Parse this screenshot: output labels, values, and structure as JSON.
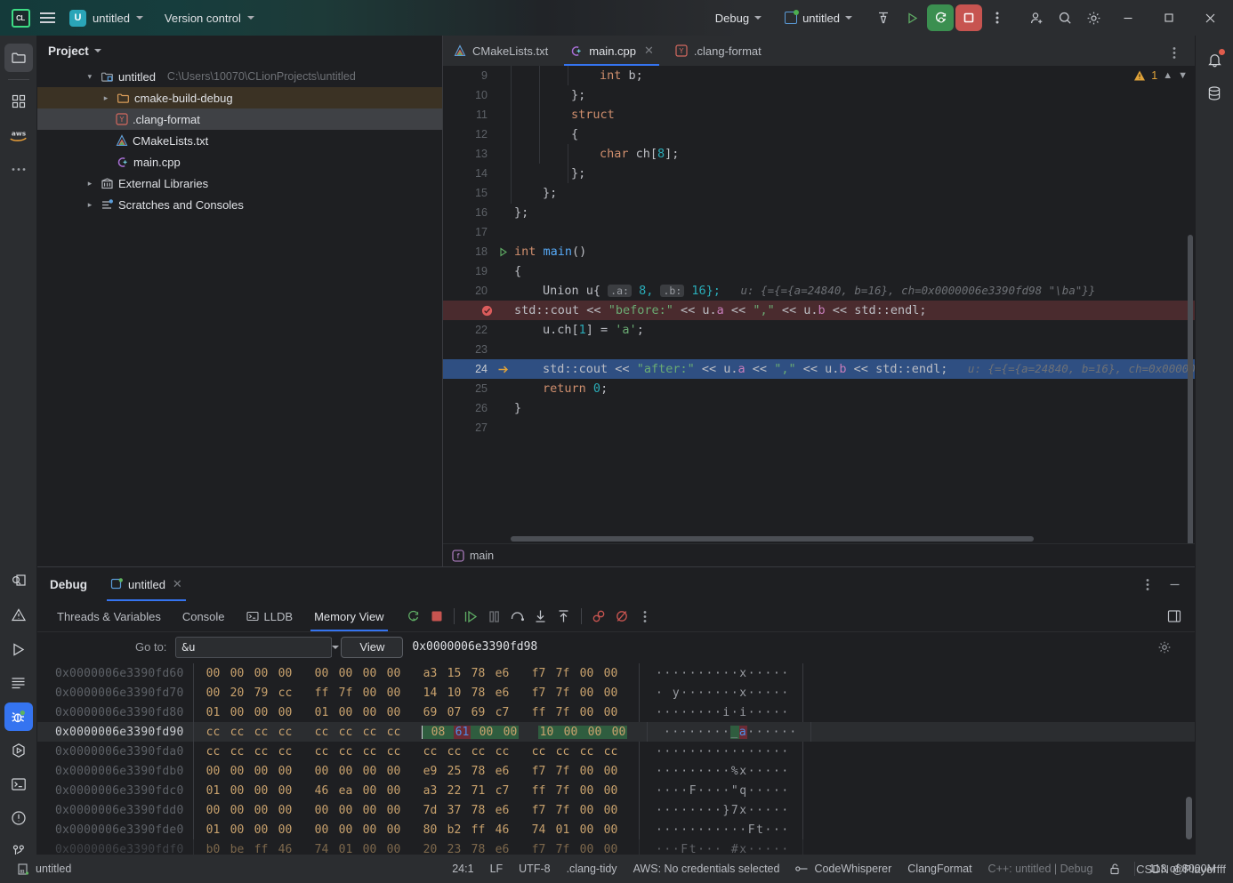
{
  "titlebar": {
    "logo": "clion-logo",
    "logo_text": "CL",
    "project_badge": "U",
    "project_name": "untitled",
    "version_control": "Version control",
    "run_config_label": "Debug",
    "run_target": "untitled",
    "icons": [
      "menu-icon",
      "build-hammer-icon",
      "run-icon",
      "debug-icon",
      "stop-icon",
      "more-icon",
      "add-user-icon",
      "search-icon",
      "settings-gear-icon",
      "minimize-icon",
      "maximize-icon",
      "close-icon"
    ]
  },
  "left_stripe": {
    "items": [
      {
        "name": "project-tool-window",
        "icon": "folder-icon",
        "active": true
      },
      {
        "name": "structure-tool-window",
        "icon": "grid-squares-icon",
        "active": false
      },
      {
        "name": "aws-toolkit",
        "icon": "aws-icon",
        "active": false
      },
      {
        "name": "more-tool-windows",
        "icon": "ellipsis-icon",
        "active": false
      },
      {
        "name": "find-tool-window",
        "icon": "find-magnifier-icon",
        "active": false
      },
      {
        "name": "problems-tool-window",
        "icon": "warning-triangle-icon",
        "active": false
      },
      {
        "name": "run-tool-window",
        "icon": "play-triangle-icon",
        "active": false
      },
      {
        "name": "todo-tool-window",
        "icon": "lines-icon",
        "active": false
      },
      {
        "name": "debug-tool-window",
        "icon": "bug-icon",
        "active": true
      },
      {
        "name": "services-tool-window",
        "icon": "hexagon-play-icon",
        "active": false
      },
      {
        "name": "terminal-tool-window",
        "icon": "terminal-icon",
        "active": false
      },
      {
        "name": "notifications-tool-window",
        "icon": "exclamation-circle-icon",
        "active": false
      },
      {
        "name": "git-tool-window",
        "icon": "git-branch-icon",
        "active": false
      }
    ]
  },
  "right_stripe": {
    "items": [
      {
        "name": "notifications",
        "icon": "bell-icon",
        "badge": true
      },
      {
        "name": "database",
        "icon": "database-icon",
        "badge": false
      }
    ]
  },
  "project_panel": {
    "header": "Project",
    "tree": [
      {
        "label": "untitled",
        "path": "C:\\Users\\10070\\CLionProjects\\untitled",
        "icon": "module-folder-icon",
        "depth": 0,
        "expanded": true,
        "state": "normal"
      },
      {
        "label": "cmake-build-debug",
        "path": "",
        "icon": "folder-orange-icon",
        "depth": 1,
        "expanded": false,
        "state": "highlight"
      },
      {
        "label": ".clang-format",
        "path": "",
        "icon": "yaml-file-icon",
        "depth": 2,
        "expanded": null,
        "state": "selected"
      },
      {
        "label": "CMakeLists.txt",
        "path": "",
        "icon": "cmake-file-icon",
        "depth": 2,
        "expanded": null,
        "state": "normal"
      },
      {
        "label": "main.cpp",
        "path": "",
        "icon": "cpp-file-icon",
        "depth": 2,
        "expanded": null,
        "state": "normal"
      },
      {
        "label": "External Libraries",
        "path": "",
        "icon": "library-icon",
        "depth": 0,
        "expanded": false,
        "state": "normal"
      },
      {
        "label": "Scratches and Consoles",
        "path": "",
        "icon": "scratches-icon",
        "depth": 0,
        "expanded": false,
        "state": "normal"
      }
    ]
  },
  "editor": {
    "tabs": [
      {
        "label": "CMakeLists.txt",
        "icon": "cmake-file-icon",
        "active": false,
        "closable": false
      },
      {
        "label": "main.cpp",
        "icon": "cpp-file-icon",
        "active": true,
        "closable": true
      },
      {
        "label": ".clang-format",
        "icon": "yaml-file-icon",
        "active": false,
        "closable": false
      }
    ],
    "inspection_warning_count": "1",
    "breadcrumb": "main",
    "breadcrumb_icon": "function-icon",
    "lines": [
      {
        "num": "9",
        "indent": 4,
        "marker": "",
        "state": "normal",
        "tokens": [
          {
            "t": "int",
            "c": "kw"
          },
          {
            "t": " b;",
            "c": "op"
          }
        ]
      },
      {
        "num": "10",
        "indent": 3,
        "marker": "",
        "state": "normal",
        "tokens": [
          {
            "t": "};",
            "c": "op"
          }
        ]
      },
      {
        "num": "11",
        "indent": 3,
        "marker": "",
        "state": "normal",
        "tokens": [
          {
            "t": "struct",
            "c": "kw"
          }
        ]
      },
      {
        "num": "12",
        "indent": 3,
        "marker": "",
        "state": "normal",
        "tokens": [
          {
            "t": "{",
            "c": "op"
          }
        ]
      },
      {
        "num": "13",
        "indent": 4,
        "marker": "",
        "state": "normal",
        "tokens": [
          {
            "t": "char",
            "c": "kw"
          },
          {
            "t": " ch[",
            "c": "op"
          },
          {
            "t": "8",
            "c": "num"
          },
          {
            "t": "];",
            "c": "op"
          }
        ]
      },
      {
        "num": "14",
        "indent": 3,
        "marker": "",
        "state": "normal",
        "tokens": [
          {
            "t": "};",
            "c": "op"
          }
        ]
      },
      {
        "num": "15",
        "indent": 2,
        "marker": "",
        "state": "normal",
        "tokens": [
          {
            "t": "};",
            "c": "op"
          }
        ]
      },
      {
        "num": "16",
        "indent": 1,
        "marker": "",
        "state": "normal",
        "tokens": [
          {
            "t": "};",
            "c": "op"
          }
        ]
      },
      {
        "num": "17",
        "indent": 0,
        "marker": "",
        "state": "normal",
        "tokens": []
      },
      {
        "num": "18",
        "indent": 1,
        "marker": "run-gutter-icon",
        "state": "normal",
        "tokens": [
          {
            "t": "int",
            "c": "kw"
          },
          {
            "t": " ",
            "c": "op"
          },
          {
            "t": "main",
            "c": "fn"
          },
          {
            "t": "()",
            "c": "op"
          }
        ]
      },
      {
        "num": "19",
        "indent": 1,
        "marker": "",
        "state": "normal",
        "tokens": [
          {
            "t": "{",
            "c": "op"
          }
        ]
      },
      {
        "num": "20",
        "indent": 2,
        "marker": "",
        "state": "normal",
        "tokens": [
          {
            "t": "Union u{",
            "c": "op"
          }
        ],
        "inlay": [
          {
            "label": ".a:",
            "value": " 8,"
          },
          {
            "label": ".b:",
            "value": " 16};"
          }
        ],
        "hint": "u: {={={a=24840, b=16}, ch=0x0000006e3390fd98 \"\\ba\"}}"
      },
      {
        "num": "21",
        "indent": 2,
        "marker": "breakpoint-icon",
        "state": "breakpoint",
        "tokens": [
          {
            "t": "std",
            "c": "op"
          },
          {
            "t": "::",
            "c": "op"
          },
          {
            "t": "cout",
            "c": "op"
          },
          {
            "t": " << ",
            "c": "op"
          },
          {
            "t": "\"before:\"",
            "c": "str"
          },
          {
            "t": " << u.",
            "c": "op"
          },
          {
            "t": "a",
            "c": "var"
          },
          {
            "t": " << ",
            "c": "op"
          },
          {
            "t": "\",\"",
            "c": "str"
          },
          {
            "t": " << u.",
            "c": "op"
          },
          {
            "t": "b",
            "c": "var"
          },
          {
            "t": " << std::endl;",
            "c": "op"
          }
        ]
      },
      {
        "num": "22",
        "indent": 2,
        "marker": "",
        "state": "normal",
        "tokens": [
          {
            "t": "u.ch[",
            "c": "op"
          },
          {
            "t": "1",
            "c": "num"
          },
          {
            "t": "] = ",
            "c": "op"
          },
          {
            "t": "'a'",
            "c": "str"
          },
          {
            "t": ";",
            "c": "op"
          }
        ]
      },
      {
        "num": "23",
        "indent": 0,
        "marker": "",
        "state": "normal",
        "tokens": []
      },
      {
        "num": "24",
        "indent": 2,
        "marker": "execution-pointer-icon",
        "state": "executing",
        "tokens": [
          {
            "t": "std",
            "c": "op"
          },
          {
            "t": "::",
            "c": "op"
          },
          {
            "t": "cout",
            "c": "op"
          },
          {
            "t": " << ",
            "c": "op"
          },
          {
            "t": "\"after:\"",
            "c": "str"
          },
          {
            "t": " << u.",
            "c": "op"
          },
          {
            "t": "a",
            "c": "var"
          },
          {
            "t": " << ",
            "c": "op"
          },
          {
            "t": "\",\"",
            "c": "str"
          },
          {
            "t": " << u.",
            "c": "op"
          },
          {
            "t": "b",
            "c": "var"
          },
          {
            "t": " << std::endl;",
            "c": "op"
          }
        ],
        "hint": "u: {={={a=24840, b=16}, ch=0x00000"
      },
      {
        "num": "25",
        "indent": 2,
        "marker": "",
        "state": "normal",
        "tokens": [
          {
            "t": "return",
            "c": "kw"
          },
          {
            "t": " ",
            "c": "op"
          },
          {
            "t": "0",
            "c": "num"
          },
          {
            "t": ";",
            "c": "op"
          }
        ]
      },
      {
        "num": "26",
        "indent": 1,
        "marker": "",
        "state": "normal",
        "tokens": [
          {
            "t": "}",
            "c": "op"
          }
        ]
      },
      {
        "num": "27",
        "indent": 0,
        "marker": "",
        "state": "normal",
        "tokens": []
      }
    ]
  },
  "debug": {
    "title": "Debug",
    "session_name": "untitled",
    "session_icon": "run-config-icon",
    "tabs": [
      {
        "label": "Threads & Variables",
        "icon": "",
        "active": false
      },
      {
        "label": "Console",
        "icon": "",
        "active": false
      },
      {
        "label": "LLDB",
        "icon": "console-icon",
        "active": false
      },
      {
        "label": "Memory View",
        "icon": "",
        "active": true
      }
    ],
    "toolbar_icons": [
      "rerun-icon",
      "stop-icon",
      "resume-icon",
      "pause-icon",
      "step-over-icon",
      "step-into-icon",
      "step-out-icon",
      "mute-breakpoints-icon",
      "view-breakpoints-icon",
      "more-icon"
    ],
    "layout_icon": "layout-settings-icon",
    "minimize_icon": "minimize-icon",
    "options_icon": "more-vertical-icon",
    "memory": {
      "goto_label": "Go to:",
      "goto_value": "&u",
      "goto_placeholder": "",
      "view_button": "View",
      "current_address": "0x0000006e3390fd98",
      "settings_icon": "settings-gear-icon",
      "rows": [
        {
          "addr": "0x0000006e3390fd60",
          "bytes": [
            "00",
            "00",
            "00",
            "00",
            "00",
            "00",
            "00",
            "00",
            "a3",
            "15",
            "78",
            "e6",
            "f7",
            "7f",
            "00",
            "00"
          ],
          "ascii": "··········x·····",
          "current": false
        },
        {
          "addr": "0x0000006e3390fd70",
          "bytes": [
            "00",
            "20",
            "79",
            "cc",
            "ff",
            "7f",
            "00",
            "00",
            "14",
            "10",
            "78",
            "e6",
            "f7",
            "7f",
            "00",
            "00"
          ],
          "ascii": "· y·······x·····",
          "current": false
        },
        {
          "addr": "0x0000006e3390fd80",
          "bytes": [
            "01",
            "00",
            "00",
            "00",
            "01",
            "00",
            "00",
            "00",
            "69",
            "07",
            "69",
            "c7",
            "ff",
            "7f",
            "00",
            "00"
          ],
          "ascii": "········i·i·····",
          "current": false
        },
        {
          "addr": "0x0000006e3390fd90",
          "bytes": [
            "cc",
            "cc",
            "cc",
            "cc",
            "cc",
            "cc",
            "cc",
            "cc",
            "08",
            "61",
            "00",
            "00",
            "10",
            "00",
            "00",
            "00"
          ],
          "ascii": "········_a······",
          "current": true,
          "highlight_from": 8,
          "highlight_to": 15,
          "byte_cursor": 9
        },
        {
          "addr": "0x0000006e3390fda0",
          "bytes": [
            "cc",
            "cc",
            "cc",
            "cc",
            "cc",
            "cc",
            "cc",
            "cc",
            "cc",
            "cc",
            "cc",
            "cc",
            "cc",
            "cc",
            "cc",
            "cc"
          ],
          "ascii": "················",
          "current": false
        },
        {
          "addr": "0x0000006e3390fdb0",
          "bytes": [
            "00",
            "00",
            "00",
            "00",
            "00",
            "00",
            "00",
            "00",
            "e9",
            "25",
            "78",
            "e6",
            "f7",
            "7f",
            "00",
            "00"
          ],
          "ascii": "·········%x·····",
          "current": false
        },
        {
          "addr": "0x0000006e3390fdc0",
          "bytes": [
            "01",
            "00",
            "00",
            "00",
            "46",
            "ea",
            "00",
            "00",
            "a3",
            "22",
            "71",
            "c7",
            "ff",
            "7f",
            "00",
            "00"
          ],
          "ascii": "····F····\"q·····",
          "current": false
        },
        {
          "addr": "0x0000006e3390fdd0",
          "bytes": [
            "00",
            "00",
            "00",
            "00",
            "00",
            "00",
            "00",
            "00",
            "7d",
            "37",
            "78",
            "e6",
            "f7",
            "7f",
            "00",
            "00"
          ],
          "ascii": "········}7x·····",
          "current": false
        },
        {
          "addr": "0x0000006e3390fde0",
          "bytes": [
            "01",
            "00",
            "00",
            "00",
            "00",
            "00",
            "00",
            "00",
            "80",
            "b2",
            "ff",
            "46",
            "74",
            "01",
            "00",
            "00"
          ],
          "ascii": "···········Ft···",
          "current": false
        },
        {
          "addr": "0x0000006e3390fdf0",
          "bytes": [
            "b0",
            "be",
            "ff",
            "46",
            "74",
            "01",
            "00",
            "00",
            "20",
            "23",
            "78",
            "e6",
            "f7",
            "7f",
            "00",
            "00"
          ],
          "ascii": "···Ft··· #x·····",
          "current": false
        }
      ]
    }
  },
  "statusbar": {
    "project": "untitled",
    "project_icon": "module-icon",
    "caret_position": "24:1",
    "line_separator": "LF",
    "encoding": "UTF-8",
    "clang_tidy": ".clang-tidy",
    "aws": "AWS: No credentials selected",
    "codewhisperer": "CodeWhisperer",
    "clang_format": "ClangFormat",
    "toolchain": "C++: untitled | Debug",
    "lock_icon": "unlocked-icon",
    "memory": "113 of 8000M",
    "watermark": "CSDN @Playerfff"
  }
}
